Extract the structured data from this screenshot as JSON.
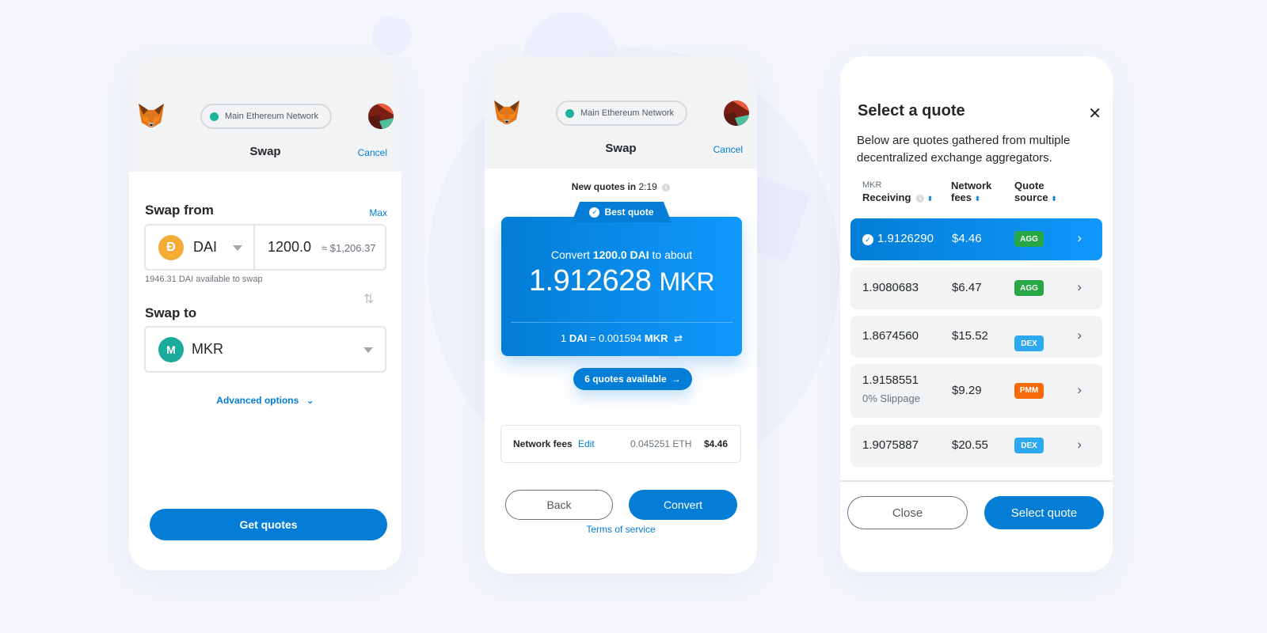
{
  "theme": {
    "primary": "#037dd6",
    "network_dot": "#1db39b",
    "dai": "#f5ac37",
    "mkr": "#1aab9b",
    "agg": "#28a745",
    "dex": "#2ea8f0",
    "pmm": "#f66a0a"
  },
  "screens": [
    {
      "header": {
        "network": "Main Ethereum Network",
        "title": "Swap",
        "cancel": "Cancel"
      },
      "swap_from": {
        "label": "Swap from",
        "max": "Max",
        "token": "DAI",
        "amount": "1200.0",
        "usd_value": "≈ $1,206.37",
        "available": "1946.31 DAI available to swap"
      },
      "swap_to": {
        "label": "Swap to",
        "token": "MKR"
      },
      "advanced_options": "Advanced options",
      "get_quotes": "Get quotes"
    },
    {
      "header": {
        "network": "Main Ethereum Network",
        "title": "Swap",
        "cancel": "Cancel"
      },
      "new_quotes_label": "New quotes in",
      "new_quotes_timer": "2:19",
      "best_quote_label": "Best quote",
      "convert_prefix": "Convert",
      "convert_amount": "1200.0 DAI",
      "convert_suffix": "to about",
      "receive_amount": "1.912628",
      "receive_unit": "MKR",
      "rate_one": "1",
      "rate_from": "DAI",
      "rate_equals": "= 0.001594",
      "rate_to": "MKR",
      "quotes_available": "6 quotes available",
      "fees": {
        "label": "Network fees",
        "edit": "Edit",
        "eth": "0.045251 ETH",
        "usd": "$4.46"
      },
      "back": "Back",
      "convert": "Convert",
      "terms": "Terms of service"
    },
    {
      "title": "Select a quote",
      "description": "Below are quotes gathered from multiple decentralized exchange aggregators.",
      "columns": {
        "receiving_unit": "MKR",
        "receiving": "Receiving",
        "fees_line1": "Network",
        "fees_line2": "fees",
        "source_line1": "Quote",
        "source_line2": "source"
      },
      "quotes": [
        {
          "amount": "1.9126290",
          "fee": "$4.46",
          "source": "AGG",
          "best": true
        },
        {
          "amount": "1.9080683",
          "fee": "$6.47",
          "source": "AGG"
        },
        {
          "amount": "1.8674560",
          "fee": "$15.52",
          "source": "DEX"
        },
        {
          "amount": "1.9158551",
          "fee": "$9.29",
          "source": "PMM",
          "note": "0% Slippage"
        },
        {
          "amount": "1.9075887",
          "fee": "$20.55",
          "source": "DEX"
        }
      ],
      "close": "Close",
      "select": "Select quote"
    }
  ]
}
